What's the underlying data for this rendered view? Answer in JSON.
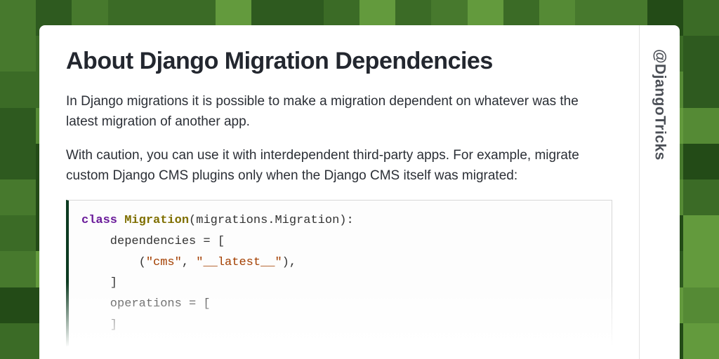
{
  "title": "About Django Migration Dependencies",
  "paragraphs": [
    "In Django migrations it is possible to make a migration dependent on whatever was the latest migration of another app.",
    "With caution, you can use it with interdependent third-party apps. For example, migrate custom Django CMS plugins only when the Django CMS itself was migrated:"
  ],
  "code": {
    "keyword_class": "class",
    "class_name": "Migration",
    "base": "(migrations.Migration):",
    "line_deps": "    dependencies = [",
    "line_tuple_open": "        (",
    "str_cms": "\"cms\"",
    "comma": ", ",
    "str_latest": "\"__latest__\"",
    "line_tuple_close": "),",
    "line_close_bracket": "    ]",
    "line_ops": "    operations = [",
    "line_ops_close": "    ]"
  },
  "handle": "@DjangoTricks",
  "bg_colors": [
    "#2e5a1f",
    "#3b6b26",
    "#47792d",
    "#558a35",
    "#639a3d",
    "#234b17"
  ]
}
